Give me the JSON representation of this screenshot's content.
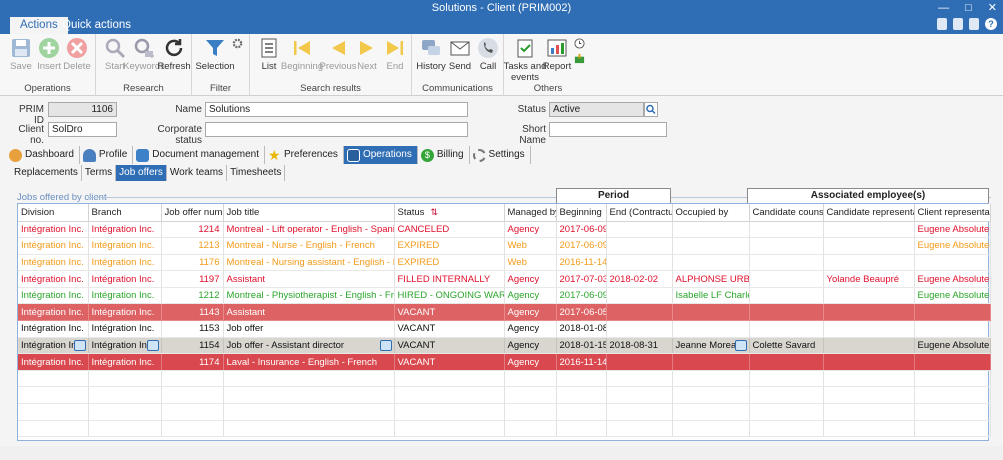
{
  "window": {
    "title": "Solutions - Client (PRIM002)"
  },
  "tabs": {
    "actions": "Actions",
    "quick_actions": "Quick actions"
  },
  "ribbon": {
    "operations": {
      "label": "Operations",
      "save": "Save",
      "insert": "Insert",
      "delete": "Delete"
    },
    "research": {
      "label": "Research",
      "start": "Start",
      "keywords": "Keywords",
      "refresh": "Refresh"
    },
    "filter": {
      "label": "Filter",
      "selection": "Selection"
    },
    "search_results": {
      "label": "Search results",
      "list": "List",
      "beginning": "Beginning",
      "previous": "Previous",
      "next": "Next",
      "end": "End"
    },
    "communications": {
      "label": "Communications",
      "history": "History",
      "send": "Send",
      "call": "Call"
    },
    "others": {
      "label": "Others",
      "tasks": "Tasks and",
      "tasks2": "events",
      "report": "Report"
    }
  },
  "form": {
    "prim_id_label": "PRIM ID",
    "prim_id": "1106",
    "name_label": "Name",
    "name": "Solutions",
    "status_label": "Status",
    "status": "Active",
    "client_no_label": "Client no.",
    "client_no": "SolDro",
    "corporate_status_label": "Corporate status",
    "corporate_status": "",
    "short_name_label": "Short Name",
    "short_name": ""
  },
  "primary_tabs": [
    "Dashboard",
    "Profile",
    "Document management",
    "Preferences",
    "Operations",
    "Billing",
    "Settings"
  ],
  "secondary_tabs": [
    "Replacements",
    "Terms",
    "Job offers",
    "Work teams",
    "Timesheets"
  ],
  "section": {
    "caption": "Jobs offered by client",
    "period": "Period",
    "associated": "Associated employee(s)"
  },
  "grid": {
    "columns": [
      "Division",
      "Branch",
      "Job offer number",
      "Job title",
      "Status",
      "Managed by",
      "Beginning",
      "End (Contractual)",
      "Occupied by",
      "Candidate counselor",
      "Candidate representative",
      "Client representative"
    ],
    "rows": [
      [
        "Intégration Inc.",
        "Intégration Inc.",
        "1214",
        "Montreal - Lift operator - English - Spanish - French",
        "CANCELED",
        "Agency",
        "2017-06-09",
        "",
        "",
        "",
        "",
        "Eugene Absolute"
      ],
      [
        "Intégration Inc.",
        "Intégration Inc.",
        "1213",
        "Montreal - Nurse - English - French",
        "EXPIRED",
        "Web",
        "2017-06-09",
        "",
        "",
        "",
        "",
        "Eugene Absolute"
      ],
      [
        "Intégration Inc.",
        "Intégration Inc.",
        "1176",
        "Montreal - Nursing assistant - English - French",
        "EXPIRED",
        "Web",
        "2016-11-14",
        "",
        "",
        "",
        "",
        ""
      ],
      [
        "Intégration Inc.",
        "Intégration Inc.",
        "1197",
        "Assistant",
        "FILLED INTERNALLY",
        "Agency",
        "2017-07-03",
        "2018-02-02",
        "ALPHONSE URBAIN",
        "",
        "Yolande Beaupré",
        "Eugene Absolute"
      ],
      [
        "Intégration Inc.",
        "Intégration Inc.",
        "1212",
        "Montreal - Physiotherapist - English - French",
        "HIRED - ONGOING WARRANTY",
        "Agency",
        "2017-06-09",
        "",
        "Isabelle LF Charlebois",
        "",
        "",
        "Eugene Absolute"
      ],
      [
        "Intégration Inc.",
        "Intégration Inc.",
        "1143",
        "Assistant",
        "VACANT",
        "Agency",
        "2017-06-05",
        "",
        "",
        "",
        "",
        ""
      ],
      [
        "Intégration Inc.",
        "Intégration Inc.",
        "1153",
        "Job offer",
        "VACANT",
        "Agency",
        "2018-01-08",
        "",
        "",
        "",
        "",
        ""
      ],
      [
        "Intégration Inc.",
        "Intégration Inc.",
        "1154",
        "Job offer - Assistant director",
        "VACANT",
        "Agency",
        "2018-01-15",
        "2018-08-31",
        "Jeanne Moreau",
        "Colette Savard",
        "",
        "Eugene Absolute"
      ],
      [
        "Intégration Inc.",
        "Intégration Inc.",
        "1174",
        "Laval - Insurance - English - French",
        "VACANT",
        "Agency",
        "2016-11-14",
        "",
        "",
        "",
        "",
        ""
      ]
    ]
  },
  "colors": {
    "title_bar": "#2f6eb5",
    "red": "#e0102c",
    "orange": "#f29a18",
    "green": "#2aa52a",
    "row_highlight": "#dd6264"
  }
}
